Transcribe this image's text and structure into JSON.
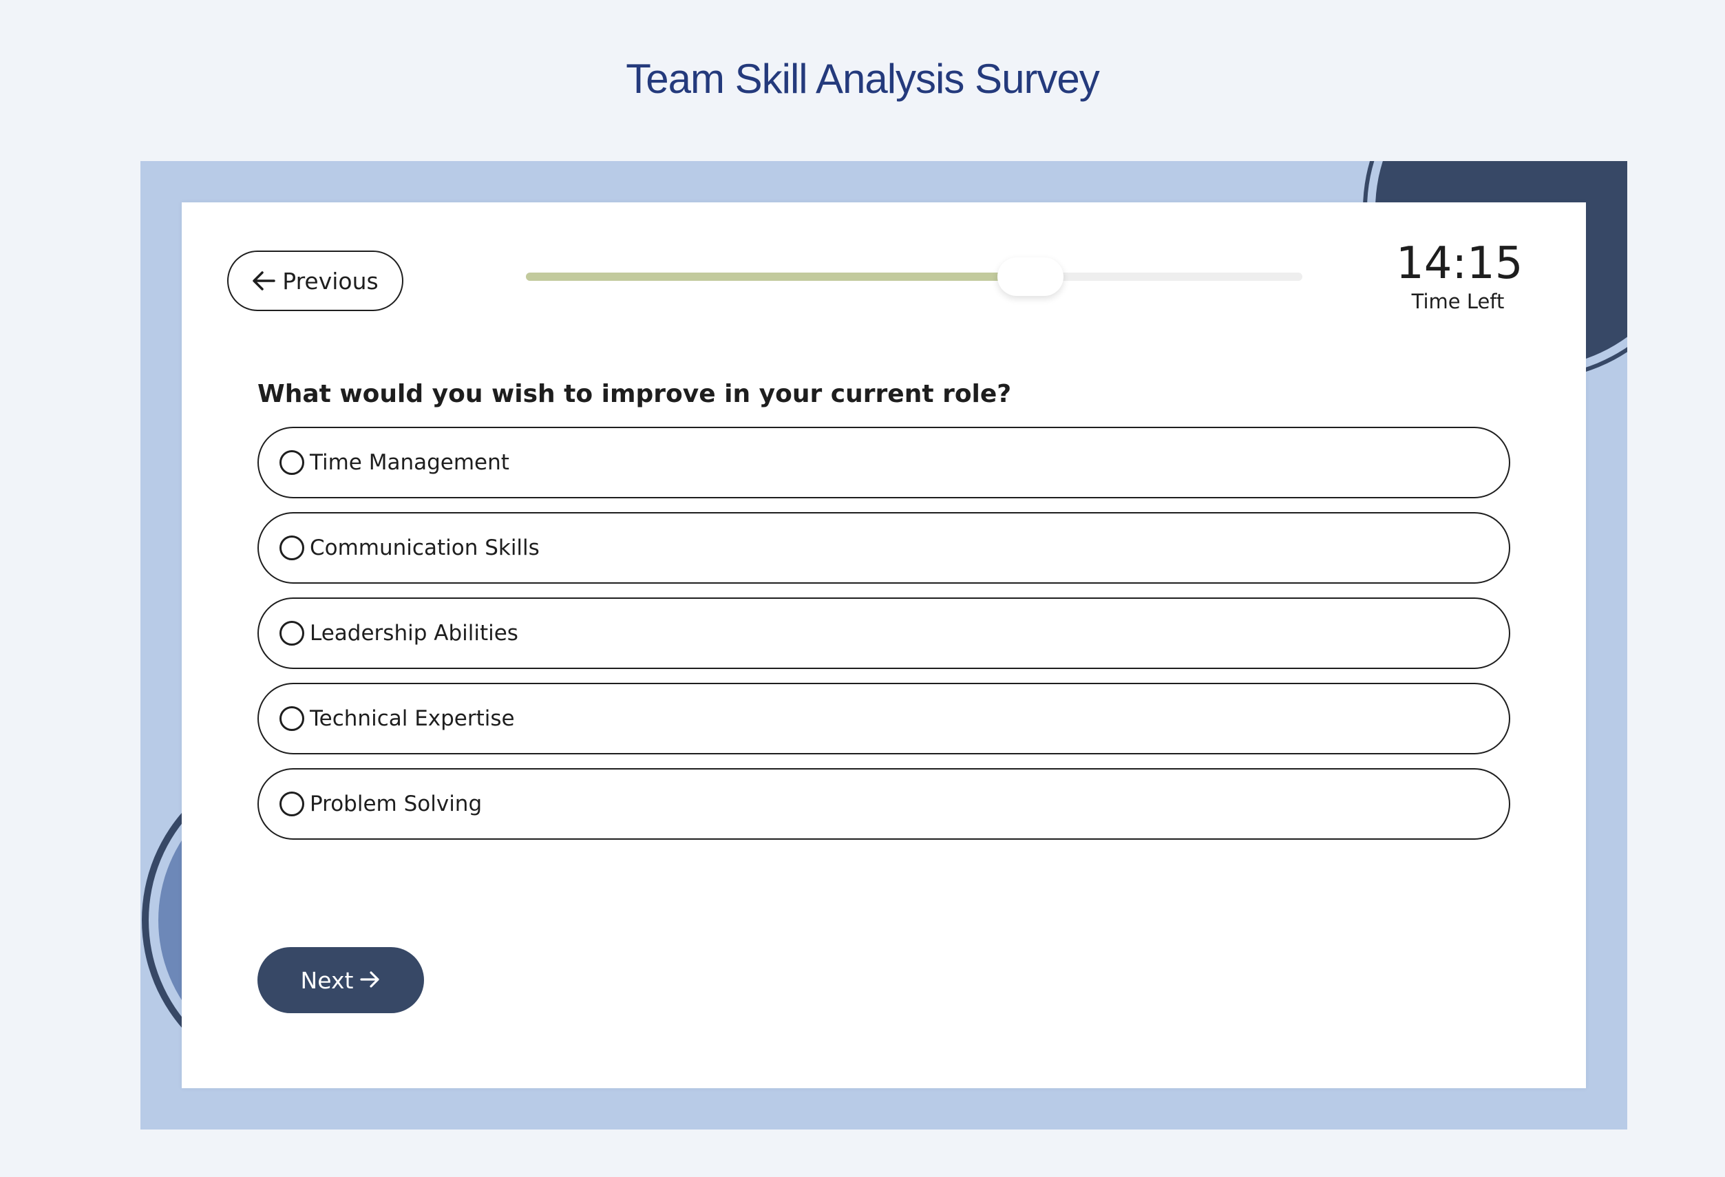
{
  "page": {
    "title": "Team Skill Analysis Survey"
  },
  "nav": {
    "previous_label": "Previous",
    "next_label": "Next"
  },
  "progress": {
    "fraction": 0.65
  },
  "timer": {
    "value": "14:15",
    "label": "Time Left"
  },
  "question": {
    "text": "What would you wish to improve in your current role?",
    "options": [
      "Time Management",
      "Communication Skills",
      "Leadership Abilities",
      "Technical Expertise",
      "Problem Solving"
    ]
  },
  "colors": {
    "title": "#243a7c",
    "frame": "#b8cbe7",
    "accent_dark": "#374866",
    "progress_fill": "#c2ca9d",
    "progress_track": "#eeeeee"
  },
  "icons": {
    "previous": "arrow-left-icon",
    "next": "arrow-right-icon",
    "option": "radio-unchecked-icon"
  }
}
